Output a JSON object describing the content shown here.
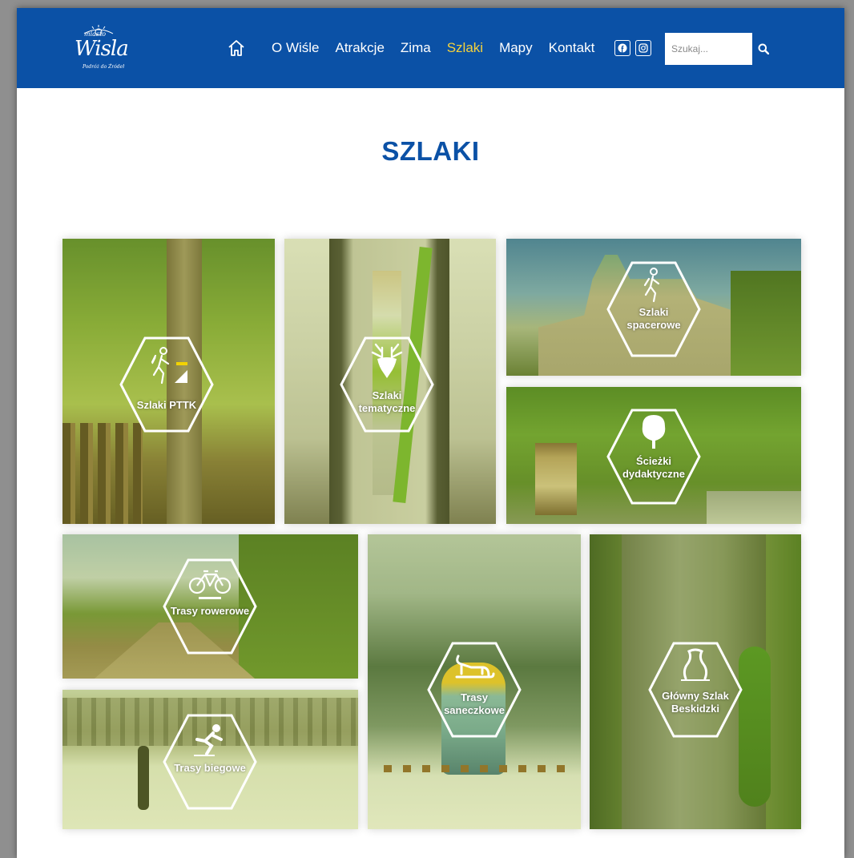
{
  "header": {
    "logo": {
      "small": "miasto",
      "name": "Wisla",
      "tagline": "Podróż do Źródeł"
    },
    "nav": [
      {
        "label": "O Wiśle",
        "active": false
      },
      {
        "label": "Atrakcje",
        "active": false
      },
      {
        "label": "Zima",
        "active": false
      },
      {
        "label": "Szlaki",
        "active": true
      },
      {
        "label": "Mapy",
        "active": false
      },
      {
        "label": "Kontakt",
        "active": false
      }
    ],
    "icons": {
      "home": "home-icon",
      "facebook": "facebook-icon",
      "instagram": "instagram-icon",
      "search": "search-icon"
    },
    "search": {
      "placeholder": "Szukaj..."
    }
  },
  "page": {
    "title": "SZLAKI"
  },
  "tiles": [
    {
      "label": "Szlaki PTTK",
      "icon": "hiker-trail-icon"
    },
    {
      "label": "Szlaki tematyczne",
      "icon": "deer-icon"
    },
    {
      "label": "Szlaki spacerowe",
      "icon": "walker-icon"
    },
    {
      "label": "Ścieżki dydaktyczne",
      "icon": "tree-icon"
    },
    {
      "label": "Trasy rowerowe",
      "icon": "bicycle-icon"
    },
    {
      "label": "Trasy biegowe",
      "icon": "skier-icon"
    },
    {
      "label": "Trasy saneczkowe",
      "icon": "sled-icon"
    },
    {
      "label": "Główny Szlak Beskidzki",
      "icon": "trail-marker-icon"
    }
  ],
  "colors": {
    "brand": "#0b51a6",
    "active": "#f5d23c",
    "overlay": "#aabe28"
  }
}
